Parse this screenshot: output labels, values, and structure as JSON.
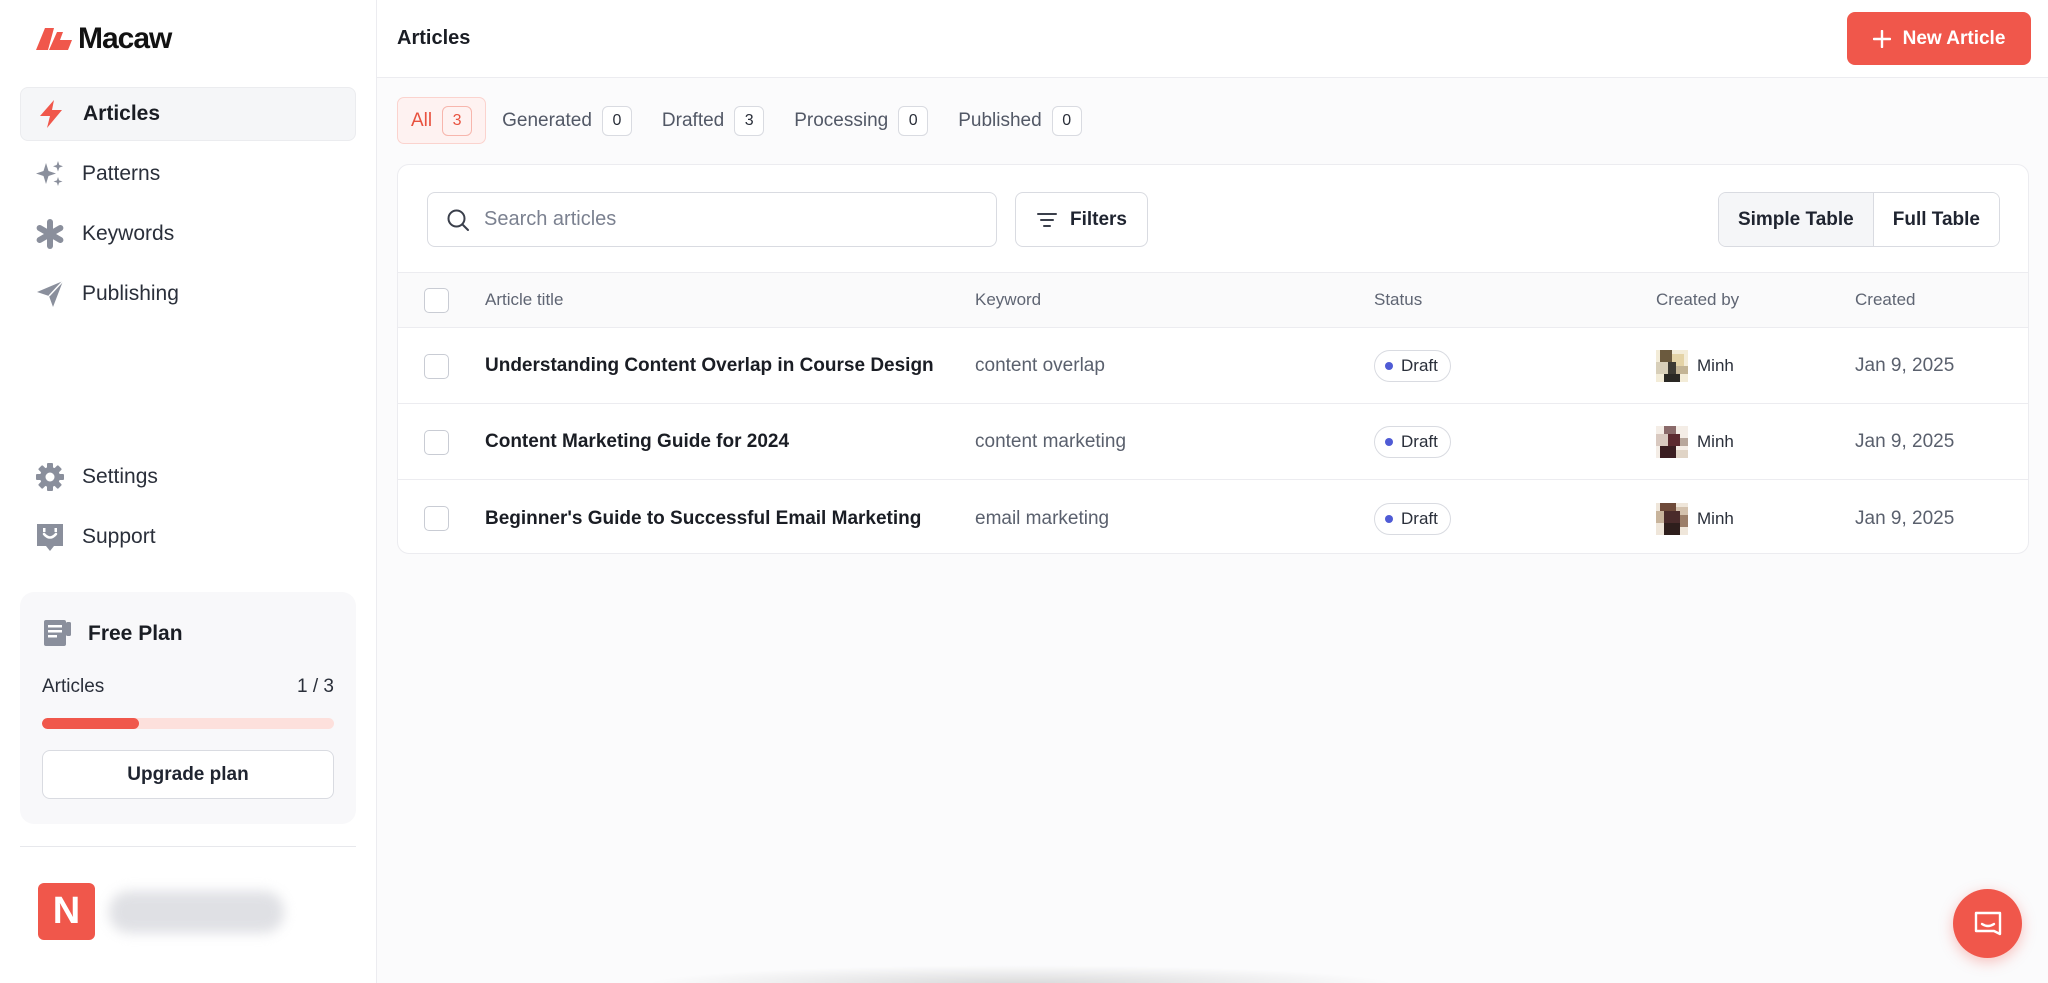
{
  "app": {
    "name": "Macaw",
    "brand_color": "#f0574b"
  },
  "sidebar": {
    "nav_items": [
      {
        "label": "Articles",
        "icon": "lightning-icon",
        "active": true
      },
      {
        "label": "Patterns",
        "icon": "sparkles-icon",
        "active": false
      },
      {
        "label": "Keywords",
        "icon": "asterisk-icon",
        "active": false
      },
      {
        "label": "Publishing",
        "icon": "send-icon",
        "active": false
      }
    ],
    "bottom_items": [
      {
        "label": "Settings",
        "icon": "gear-icon"
      },
      {
        "label": "Support",
        "icon": "support-icon"
      }
    ],
    "plan": {
      "title": "Free Plan",
      "usage_label": "Articles",
      "usage_value": "1 / 3",
      "usage_fraction": 0.333,
      "upgrade_label": "Upgrade plan"
    },
    "user": {
      "initial": "N"
    }
  },
  "header": {
    "title": "Articles",
    "new_article_label": "New Article"
  },
  "tabs": [
    {
      "label": "All",
      "count": "3",
      "active": true
    },
    {
      "label": "Generated",
      "count": "0",
      "active": false
    },
    {
      "label": "Drafted",
      "count": "3",
      "active": false
    },
    {
      "label": "Processing",
      "count": "0",
      "active": false
    },
    {
      "label": "Published",
      "count": "0",
      "active": false
    }
  ],
  "toolbar": {
    "search_placeholder": "Search articles",
    "filters_label": "Filters",
    "view_simple": "Simple Table",
    "view_full": "Full Table"
  },
  "table": {
    "columns": {
      "title": "Article title",
      "keyword": "Keyword",
      "status": "Status",
      "created_by": "Created by",
      "created": "Created"
    },
    "rows": [
      {
        "title": "Understanding Content Overlap in Course Design",
        "keyword": "content overlap",
        "status": "Draft",
        "created_by": "Minh",
        "created": "Jan 9, 2025"
      },
      {
        "title": "Content Marketing Guide for 2024",
        "keyword": "content marketing",
        "status": "Draft",
        "created_by": "Minh",
        "created": "Jan 9, 2025"
      },
      {
        "title": "Beginner's Guide to Successful Email Marketing",
        "keyword": "email marketing",
        "status": "Draft",
        "created_by": "Minh",
        "created": "Jan 9, 2025"
      }
    ]
  }
}
